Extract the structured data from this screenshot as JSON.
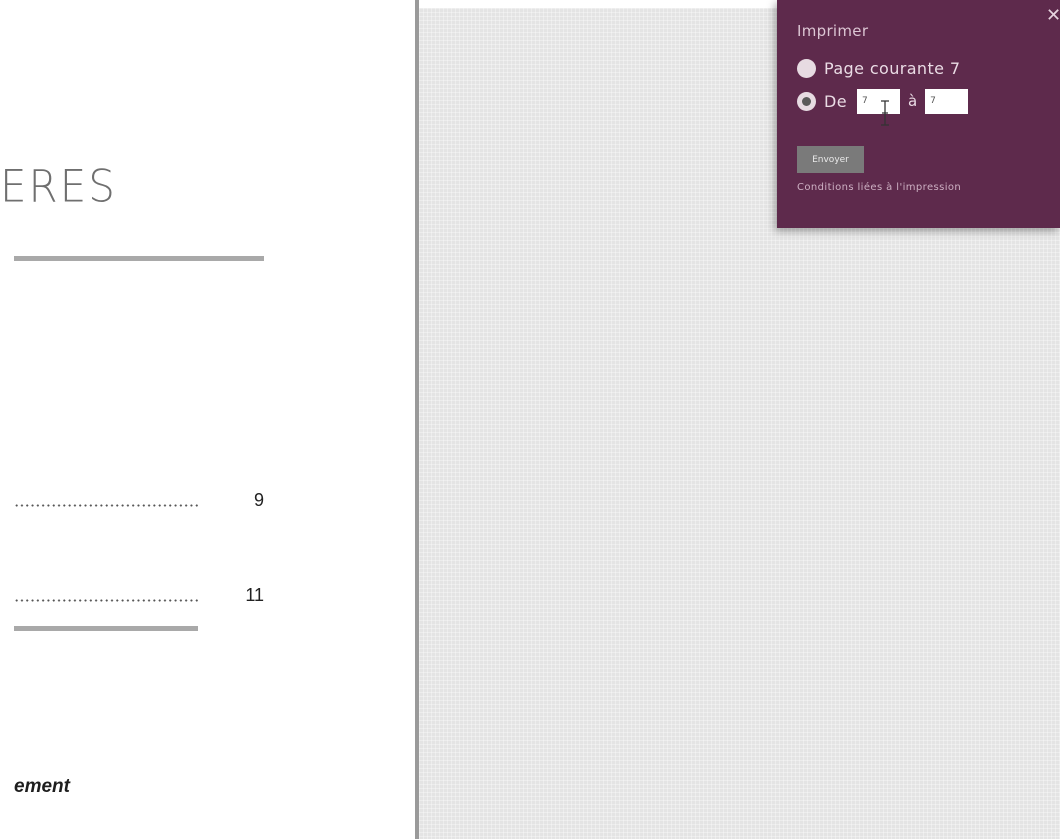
{
  "document": {
    "heading": "ERES",
    "toc": [
      {
        "page": "9"
      },
      {
        "page": "11"
      }
    ],
    "footer_text": "ement"
  },
  "print_dialog": {
    "title": "Imprimer",
    "close_icon": "close-icon",
    "option_current_page": "Page courante 7",
    "option_range_from_label": "De",
    "range_from_value": "7",
    "range_separator": "à",
    "range_to_value": "7",
    "selected_option": "range",
    "send_label": "Envoyer",
    "conditions_link": "Conditions liées à l'impression"
  },
  "colors": {
    "panel_bg": "#5e2a4c",
    "canvas_bg": "#e4e4e4",
    "rule_grey": "#a9a9a9"
  },
  "cursor": "text-cursor-icon"
}
